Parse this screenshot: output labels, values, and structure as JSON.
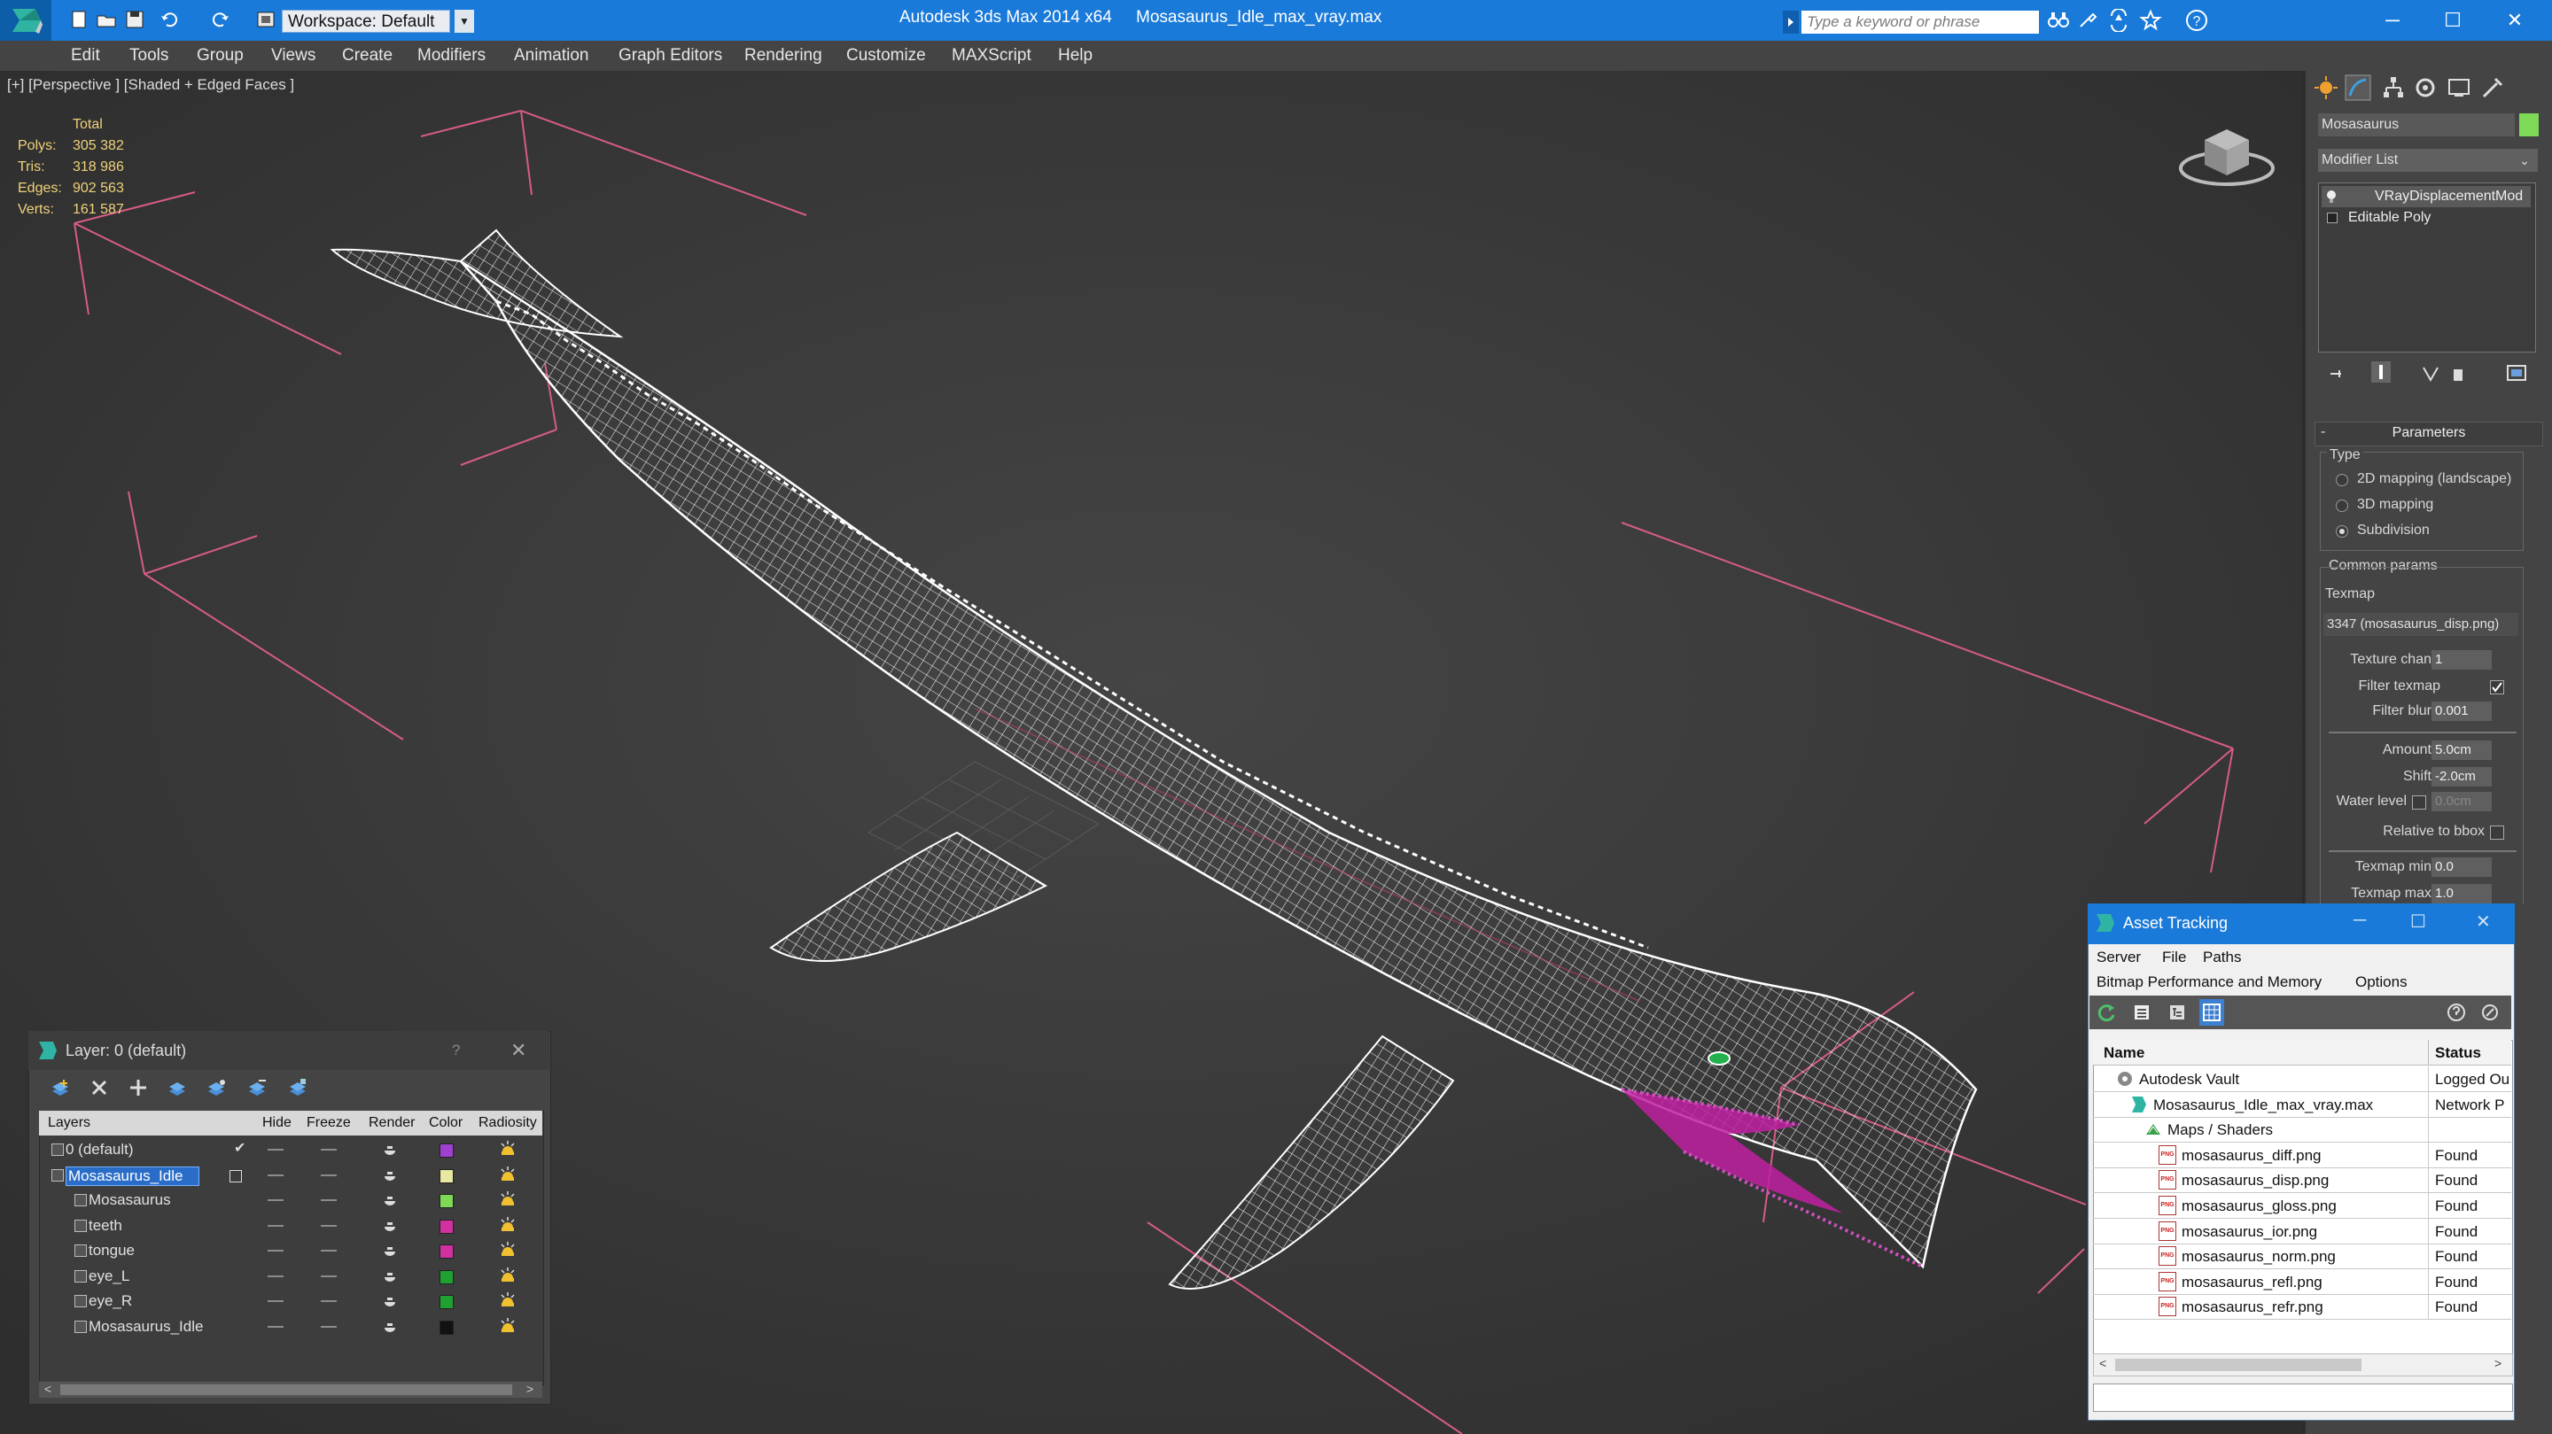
{
  "titlebar": {
    "app_title": "Autodesk 3ds Max  2014 x64",
    "file_title": "Mosasaurus_Idle_max_vray.max",
    "workspace": "Workspace: Default",
    "search_placeholder": "Type a keyword or phrase",
    "help_symbol": "?"
  },
  "menu": [
    "Edit",
    "Tools",
    "Group",
    "Views",
    "Create",
    "Modifiers",
    "Animation",
    "Graph Editors",
    "Rendering",
    "Customize",
    "MAXScript",
    "Help"
  ],
  "viewport": {
    "label": "[+] [Perspective ] [Shaded + Edged Faces ]",
    "stats": {
      "header": "Total",
      "rows": [
        {
          "label": "Polys:",
          "value": "305 382"
        },
        {
          "label": "Tris:",
          "value": "318 986"
        },
        {
          "label": "Edges:",
          "value": "902 563"
        },
        {
          "label": "Verts:",
          "value": "161 587"
        }
      ]
    }
  },
  "command_panel": {
    "object_name": "Mosasaurus",
    "object_color": "#7ed957",
    "modifier_list": "Modifier List",
    "stack": [
      "VRayDisplacementMod",
      "Editable Poly"
    ],
    "rollout_title": "Parameters",
    "type_label": "Type",
    "type_options": [
      {
        "label": "2D mapping (landscape)",
        "selected": false
      },
      {
        "label": "3D mapping",
        "selected": false
      },
      {
        "label": "Subdivision",
        "selected": true
      }
    ],
    "common_params": "Common params",
    "texmap_label": "Texmap",
    "texmap_value": "3347 (mosasaurus_disp.png)",
    "texture_chan_label": "Texture chan",
    "texture_chan_value": "1",
    "filter_texmap_label": "Filter texmap",
    "filter_texmap_checked": true,
    "filter_blur_label": "Filter blur",
    "filter_blur_value": "0.001",
    "amount_label": "Amount",
    "amount_value": "5.0cm",
    "shift_label": "Shift",
    "shift_value": "-2.0cm",
    "water_level_label": "Water level",
    "water_level_value": "0.0cm",
    "relative_bbox_label": "Relative to bbox",
    "texmap_min_label": "Texmap min",
    "texmap_min_value": "0.0",
    "texmap_max_label": "Texmap max",
    "texmap_max_value": "1.0"
  },
  "layer_window": {
    "title": "Layer: 0 (default)",
    "columns": [
      "Layers",
      "Hide",
      "Freeze",
      "Render",
      "Color",
      "Radiosity"
    ],
    "rows": [
      {
        "name": "0 (default)",
        "indent": 0,
        "color": "#a040d0",
        "selected": false,
        "active": true
      },
      {
        "name": "Mosasaurus_Idle",
        "indent": 0,
        "color": "#e8e8a0",
        "selected": true,
        "active": false
      },
      {
        "name": "Mosasaurus",
        "indent": 1,
        "color": "#7ed957",
        "selected": false,
        "active": false
      },
      {
        "name": "teeth",
        "indent": 1,
        "color": "#d030a0",
        "selected": false,
        "active": false
      },
      {
        "name": "tongue",
        "indent": 1,
        "color": "#d030a0",
        "selected": false,
        "active": false
      },
      {
        "name": "eye_L",
        "indent": 1,
        "color": "#20a030",
        "selected": false,
        "active": false
      },
      {
        "name": "eye_R",
        "indent": 1,
        "color": "#20a030",
        "selected": false,
        "active": false
      },
      {
        "name": "Mosasaurus_Idle",
        "indent": 1,
        "color": "#111111",
        "selected": false,
        "active": false
      }
    ]
  },
  "asset_window": {
    "title": "Asset Tracking",
    "menu": [
      "Server",
      "File",
      "Paths"
    ],
    "menu2": [
      "Bitmap Performance and Memory",
      "Options"
    ],
    "columns": [
      "Name",
      "Status"
    ],
    "rows": [
      {
        "name": "Autodesk Vault",
        "status": "Logged Ou",
        "indent": 1,
        "kind": "vault"
      },
      {
        "name": "Mosasaurus_Idle_max_vray.max",
        "status": "Network P",
        "indent": 2,
        "kind": "max"
      },
      {
        "name": "Maps / Shaders",
        "status": "",
        "indent": 3,
        "kind": "folder"
      },
      {
        "name": "mosasaurus_diff.png",
        "status": "Found",
        "indent": 4,
        "kind": "png"
      },
      {
        "name": "mosasaurus_disp.png",
        "status": "Found",
        "indent": 4,
        "kind": "png"
      },
      {
        "name": "mosasaurus_gloss.png",
        "status": "Found",
        "indent": 4,
        "kind": "png"
      },
      {
        "name": "mosasaurus_ior.png",
        "status": "Found",
        "indent": 4,
        "kind": "png"
      },
      {
        "name": "mosasaurus_norm.png",
        "status": "Found",
        "indent": 4,
        "kind": "png"
      },
      {
        "name": "mosasaurus_refl.png",
        "status": "Found",
        "indent": 4,
        "kind": "png"
      },
      {
        "name": "mosasaurus_refr.png",
        "status": "Found",
        "indent": 4,
        "kind": "png"
      }
    ],
    "png_badge": "PNG"
  }
}
